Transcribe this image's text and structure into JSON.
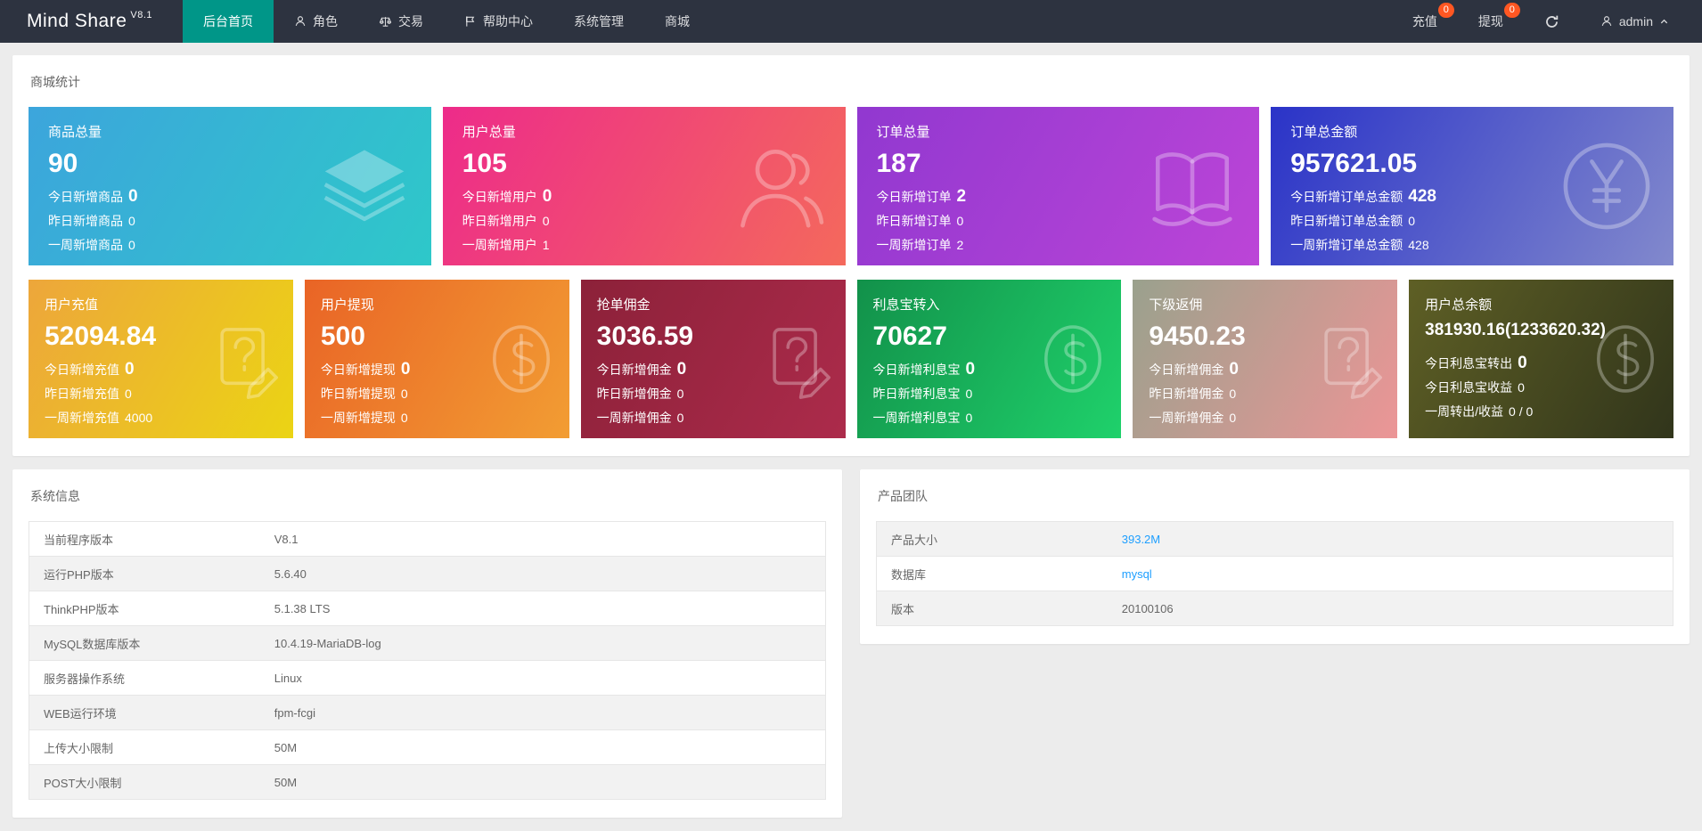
{
  "colors": {
    "accent": "#009688",
    "badge": "#FF5722",
    "link": "#1E9FFF",
    "navbar": "#2D3340",
    "page_bg": "#ececec"
  },
  "navbar": {
    "logo": "Mind Share",
    "version": "V8.1",
    "items": [
      {
        "label": "后台首页"
      },
      {
        "label": "角色"
      },
      {
        "label": "交易"
      },
      {
        "label": "帮助中心"
      },
      {
        "label": "系统管理"
      },
      {
        "label": "商城"
      }
    ],
    "recharge": {
      "label": "充值",
      "badge": "0"
    },
    "withdraw": {
      "label": "提现",
      "badge": "0"
    },
    "user": {
      "name": "admin"
    }
  },
  "stats": {
    "title": "商城统计",
    "row1": [
      {
        "title": "商品总量",
        "value": "90",
        "gradient": [
          "#3CA5DC",
          "#2EC8C9"
        ],
        "icon": "layers-icon",
        "lines": [
          {
            "label": "今日新增商品",
            "value": "0"
          },
          {
            "label": "昨日新增商品",
            "value": "0"
          },
          {
            "label": "一周新增商品",
            "value": "0"
          }
        ]
      },
      {
        "title": "用户总量",
        "value": "105",
        "gradient": [
          "#ED2B8A",
          "#F4695C"
        ],
        "icon": "users-icon",
        "lines": [
          {
            "label": "今日新增用户",
            "value": "0"
          },
          {
            "label": "昨日新增用户",
            "value": "0"
          },
          {
            "label": "一周新增用户",
            "value": "1"
          }
        ]
      },
      {
        "title": "订单总量",
        "value": "187",
        "gradient": [
          "#9138D0",
          "#BC45D7"
        ],
        "icon": "book-icon",
        "lines": [
          {
            "label": "今日新增订单",
            "value": "2"
          },
          {
            "label": "昨日新增订单",
            "value": "0"
          },
          {
            "label": "一周新增订单",
            "value": "2"
          }
        ]
      },
      {
        "title": "订单总金额",
        "value": "957621.05",
        "gradient": [
          "#2A33C8",
          "#8289CC"
        ],
        "icon": "yen-icon",
        "lines": [
          {
            "label": "今日新增订单总金额",
            "value": "428"
          },
          {
            "label": "昨日新增订单总金额",
            "value": "0"
          },
          {
            "label": "一周新增订单总金额",
            "value": "428"
          }
        ]
      }
    ],
    "row2": [
      {
        "title": "用户充值",
        "value": "52094.84",
        "gradient": [
          "#EDA63B",
          "#EBD414"
        ],
        "icon": "doc-question-icon",
        "lines": [
          {
            "label": "今日新增充值",
            "value": "0"
          },
          {
            "label": "昨日新增充值",
            "value": "0"
          },
          {
            "label": "一周新增充值",
            "value": "4000"
          }
        ]
      },
      {
        "title": "用户提现",
        "value": "500",
        "gradient": [
          "#E96426",
          "#F29D33"
        ],
        "icon": "dollar-icon",
        "lines": [
          {
            "label": "今日新增提现",
            "value": "0"
          },
          {
            "label": "昨日新增提现",
            "value": "0"
          },
          {
            "label": "一周新增提现",
            "value": "0"
          }
        ]
      },
      {
        "title": "抢单佣金",
        "value": "3036.59",
        "gradient": [
          "#8C2139",
          "#AC2B4B"
        ],
        "icon": "doc-question-icon",
        "lines": [
          {
            "label": "今日新增佣金",
            "value": "0"
          },
          {
            "label": "昨日新增佣金",
            "value": "0"
          },
          {
            "label": "一周新增佣金",
            "value": "0"
          }
        ]
      },
      {
        "title": "利息宝转入",
        "value": "70627",
        "gradient": [
          "#12914A",
          "#1FD16B"
        ],
        "icon": "dollar-icon",
        "lines": [
          {
            "label": "今日新增利息宝",
            "value": "0"
          },
          {
            "label": "昨日新增利息宝",
            "value": "0"
          },
          {
            "label": "一周新增利息宝",
            "value": "0"
          }
        ]
      },
      {
        "title": "下级返佣",
        "value": "9450.23",
        "gradient": [
          "#9AA18D",
          "#EC9596"
        ],
        "icon": "doc-question-icon",
        "lines": [
          {
            "label": "今日新增佣金",
            "value": "0"
          },
          {
            "label": "昨日新增佣金",
            "value": "0"
          },
          {
            "label": "一周新增佣金",
            "value": "0"
          }
        ]
      },
      {
        "title": "用户总余额",
        "value": "381930.16(1233620.32)",
        "gradient": [
          "#5E5F25",
          "#31351B"
        ],
        "icon": "dollar-icon",
        "lines": [
          {
            "label": "今日利息宝转出",
            "value": "0"
          },
          {
            "label": "今日利息宝收益",
            "value": "0"
          },
          {
            "label": "一周转出/收益",
            "value": "0 / 0"
          }
        ]
      }
    ]
  },
  "system_info": {
    "title": "系统信息",
    "rows": [
      {
        "label": "当前程序版本",
        "value": "V8.1"
      },
      {
        "label": "运行PHP版本",
        "value": "5.6.40"
      },
      {
        "label": "ThinkPHP版本",
        "value": "5.1.38 LTS"
      },
      {
        "label": "MySQL数据库版本",
        "value": "10.4.19-MariaDB-log"
      },
      {
        "label": "服务器操作系统",
        "value": "Linux"
      },
      {
        "label": "WEB运行环境",
        "value": "fpm-fcgi"
      },
      {
        "label": "上传大小限制",
        "value": "50M"
      },
      {
        "label": "POST大小限制",
        "value": "50M"
      }
    ]
  },
  "product_team": {
    "title": "产品团队",
    "rows": [
      {
        "label": "产品大小",
        "value": "393.2M"
      },
      {
        "label": "数据库",
        "value": "mysql"
      },
      {
        "label": "版本",
        "value": "20100106"
      }
    ]
  }
}
